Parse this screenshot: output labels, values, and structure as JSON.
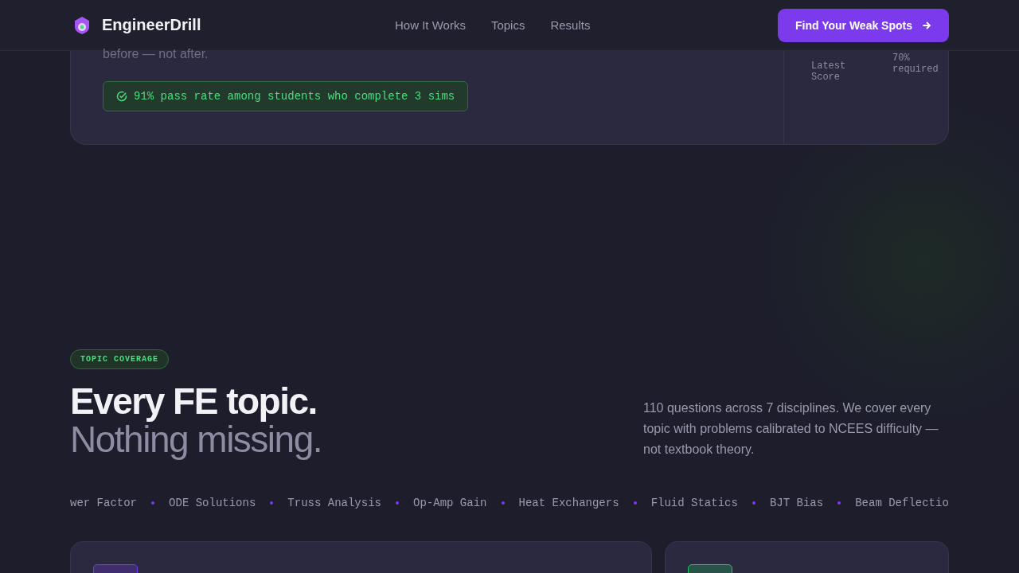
{
  "nav": {
    "brand": "EngineerDrill",
    "links": [
      {
        "label": "How It Works"
      },
      {
        "label": "Topics"
      },
      {
        "label": "Results"
      }
    ],
    "cta": "Find Your Weak Spots"
  },
  "intro_card": {
    "text_tail": "before — not after.",
    "badge": "91% pass rate among students who complete 3 sims",
    "score_label": "Latest Score",
    "score_note": "70% required"
  },
  "coverage": {
    "eyebrow": "TOPIC COVERAGE",
    "title_line1": "Every FE topic.",
    "title_line2": "Nothing missing.",
    "description": "110 questions across 7 disciplines. We cover every topic with problems calibrated to NCEES difficulty — not textbook theory.",
    "ticker": [
      "wer Factor",
      "ODE Solutions",
      "Truss Analysis",
      "Op-Amp Gain",
      "Heat Exchangers",
      "Fluid Statics",
      "BJT Bias",
      "Beam Deflectio"
    ]
  },
  "cards": [
    {
      "color": "#7c3aed"
    },
    {
      "color": "#22c55e"
    }
  ]
}
